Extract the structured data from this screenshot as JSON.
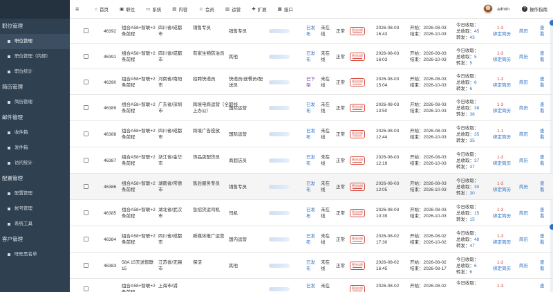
{
  "sidebar": {
    "groups": [
      {
        "title": "职位管理",
        "items": [
          {
            "label": "职位管理",
            "active": true
          },
          {
            "label": "职位管理（内部）"
          },
          {
            "label": "职位统计"
          }
        ]
      },
      {
        "title": "简历管理",
        "items": [
          {
            "label": "简历管理"
          }
        ]
      },
      {
        "title": "邮件管理",
        "items": [
          {
            "label": "收件箱"
          },
          {
            "label": "发件箱"
          },
          {
            "label": "访问统计"
          }
        ]
      },
      {
        "title": "配置管理",
        "items": [
          {
            "label": "配置管理"
          },
          {
            "label": "帐号管理"
          },
          {
            "label": "系统工具"
          }
        ]
      },
      {
        "title": "客户管理",
        "items": [
          {
            "label": "旺旺黑名单"
          }
        ]
      }
    ]
  },
  "topbar": {
    "nav": [
      {
        "label": "首页",
        "icon": "home-icon"
      },
      {
        "label": "职位",
        "icon": "briefcase-icon"
      },
      {
        "label": "系统",
        "icon": "monitor-icon"
      },
      {
        "label": "内容",
        "icon": "document-icon"
      },
      {
        "label": "会员",
        "icon": "users-icon"
      },
      {
        "label": "运营",
        "icon": "chart-icon"
      },
      {
        "label": "扩展",
        "icon": "puzzle-icon"
      },
      {
        "label": "接口",
        "icon": "plug-icon"
      }
    ],
    "user": "admin",
    "help": "操作指南"
  },
  "rows": [
    {
      "id": "46392",
      "name": "组合A58+智联+2条前程",
      "loc": "四川省/成都市",
      "title": "销售专员",
      "type": "销售专员",
      "pub": "已发布",
      "online": "未在线",
      "status": "正常",
      "date": "2026-08-03 16:43",
      "start": "开始：2026-08-03",
      "end": "结束：2026-10-03",
      "today": "今日收取：",
      "total": "总收取：",
      "total_v": "45",
      "fwd": "转发：",
      "fwd_v": "43",
      "ratio": "1-3",
      "bind": "绑定简历",
      "resume": "简历",
      "view": "查看",
      "pubColor": "link"
    },
    {
      "id": "46391",
      "name": "组合A58+智联+2条前程",
      "loc": "四川省/成都市",
      "title": "有家生物防治员",
      "type": "其他",
      "pub": "已发布",
      "online": "未在线",
      "status": "正常",
      "date": "2026-08-03 16:03",
      "start": "开始：2026-08-03",
      "end": "结束：2026-10-03",
      "today": "今日收取：",
      "total": "总收取：",
      "total_v": "5",
      "fwd": "转发：",
      "fwd_v": "5",
      "ratio": "1-3",
      "bind": "绑定简历",
      "resume": "简历",
      "view": "查看",
      "pubColor": "link"
    },
    {
      "id": "46390",
      "name": "组合A58+智联+2条前程",
      "loc": "河南省/南阳市",
      "title": "招聘快递员",
      "type": "快递员/送餐员/配送员",
      "pub": "已下架",
      "online": "未在线",
      "status": "正常",
      "date": "2026-08-03 15:04",
      "start": "开始：2026-08-03",
      "end": "结束：2026-10-03",
      "today": "今日收取：",
      "total": "总收取：",
      "total_v": "6",
      "fwd": "转发：",
      "fwd_v": "6",
      "ratio": "1-3",
      "bind": "绑定简历",
      "resume": "简历",
      "view": "查看",
      "pubColor": "purple"
    },
    {
      "id": "46389",
      "name": "组合A58+智联+2条前程",
      "loc": "广东省/深圳市",
      "title": "跨境电商运营（全职线上办公）",
      "type": "国际运营",
      "pub": "已发布",
      "online": "未在线",
      "status": "正常",
      "date": "2026-08-03 13:50",
      "start": "开始：2026-08-03",
      "end": "结束：2026-10-03",
      "today": "今日收取：",
      "total": "总收取：",
      "total_v": "38",
      "fwd": "转发：",
      "fwd_v": "38",
      "ratio": "1-3",
      "bind": "绑定简历",
      "resume": "简历",
      "view": "查看",
      "pubColor": "link"
    },
    {
      "id": "46388",
      "name": "组合A58+智联+2条前程",
      "loc": "四川省/成都市",
      "title": "跨境广告投放",
      "type": "国际运营",
      "pub": "已发布",
      "online": "未在线",
      "status": "正常",
      "date": "2026-08-03 12:44",
      "start": "开始：2026-08-03",
      "end": "结束：2026-10-03",
      "today": "今日收取：",
      "total": "总收取：",
      "total_v": "35",
      "fwd": "转发：",
      "fwd_v": "35",
      "ratio": "1-1",
      "bind": "绑定简历",
      "resume": "简历",
      "view": "查看",
      "pubColor": "link"
    },
    {
      "id": "46387",
      "name": "组合A58+智联+2条前程",
      "loc": "浙江省/金华市",
      "title": "饰品店配货员",
      "type": "商超店员",
      "pub": "已发布",
      "online": "未在线",
      "status": "正常",
      "date": "2026-08-03 12:19",
      "start": "开始：2026-08-03",
      "end": "结束：2026-10-03",
      "today": "今日收取：",
      "total": "总收取：",
      "total_v": "37",
      "fwd": "转发：",
      "fwd_v": "37",
      "ratio": "1-3",
      "bind": "绑定简历",
      "resume": "简历",
      "view": "查看",
      "pubColor": "link"
    },
    {
      "id": "46386",
      "name": "组合A58+智联+2条前程",
      "loc": "湖南省/常德市",
      "title": "售后服务专员",
      "type": "销售专员",
      "pub": "已发布",
      "online": "未在线",
      "status": "正常",
      "date": "2026-08-03 12:05",
      "start": "开始：2026-08-03",
      "end": "结束：2026-10-03",
      "today": "今日收取：",
      "total": "总收取：",
      "total_v": "30",
      "fwd": "转发：",
      "fwd_v": "30",
      "ratio": "1-3",
      "bind": "绑定简历",
      "resume": "简历",
      "view": "查看",
      "pubColor": "link"
    },
    {
      "id": "46385",
      "name": "组合A58+智联+2条前程",
      "loc": "湖北省/武汉市",
      "title": "急招货运司机",
      "type": "司机",
      "pub": "已发布",
      "online": "未在线",
      "status": "正常",
      "date": "2026-08-03 10:39",
      "start": "开始：2026-08-03",
      "end": "结束：2026-10-03",
      "today": "今日收取：",
      "total": "总收取：",
      "total_v": "15",
      "fwd": "转发：",
      "fwd_v": "15",
      "ratio": "1-3",
      "bind": "绑定简历",
      "resume": "简历",
      "view": "查看",
      "pubColor": "link"
    },
    {
      "id": "46384",
      "name": "组合A58+智联+2条前程",
      "loc": "四川省/成都市",
      "title": "新媒体推广运营",
      "type": "国内运营",
      "pub": "已发布",
      "online": "未在线",
      "status": "正常",
      "date": "2026-08-02 17:30",
      "start": "开始：2026-08-02",
      "end": "结束：2026-10-02",
      "today": "今日收取：",
      "total": "总收取：",
      "total_v": "48",
      "fwd": "转发：",
      "fwd_v": "47",
      "ratio": "1-3",
      "bind": "绑定简历",
      "resume": "简历",
      "view": "查看",
      "pubColor": "link"
    },
    {
      "id": "46383",
      "name": "58A 15天送智联15",
      "loc": "江苏省/无锡市",
      "title": "保洁",
      "type": "其他",
      "pub": "已发布",
      "online": "未在线",
      "status": "正常",
      "date": "2026-08-02 16:45",
      "start": "开始：2026-08-02",
      "end": "结束：2026-08-17",
      "today": "今日收取：",
      "total": "总收取：",
      "total_v": "6",
      "fwd": "转发：",
      "fwd_v": "6",
      "ratio": "1-2",
      "bind": "绑定简历",
      "resume": "简历",
      "view": "查看",
      "pubColor": "link"
    },
    {
      "id": "",
      "name": "组合A58+智联+2条前程",
      "loc": "上海市/浦",
      "title": "",
      "type": "",
      "pub": "已发",
      "online": "未在",
      "status": "",
      "date": "2026-08-02",
      "start": "开始：2026-08-02",
      "end": "",
      "today": "今日收取：",
      "total": "",
      "total_v": "",
      "fwd": "",
      "fwd_v": "",
      "ratio": "1-3",
      "bind": "",
      "resume": "",
      "view": "查",
      "pubColor": "link"
    }
  ],
  "stamp_text": "营业执照"
}
